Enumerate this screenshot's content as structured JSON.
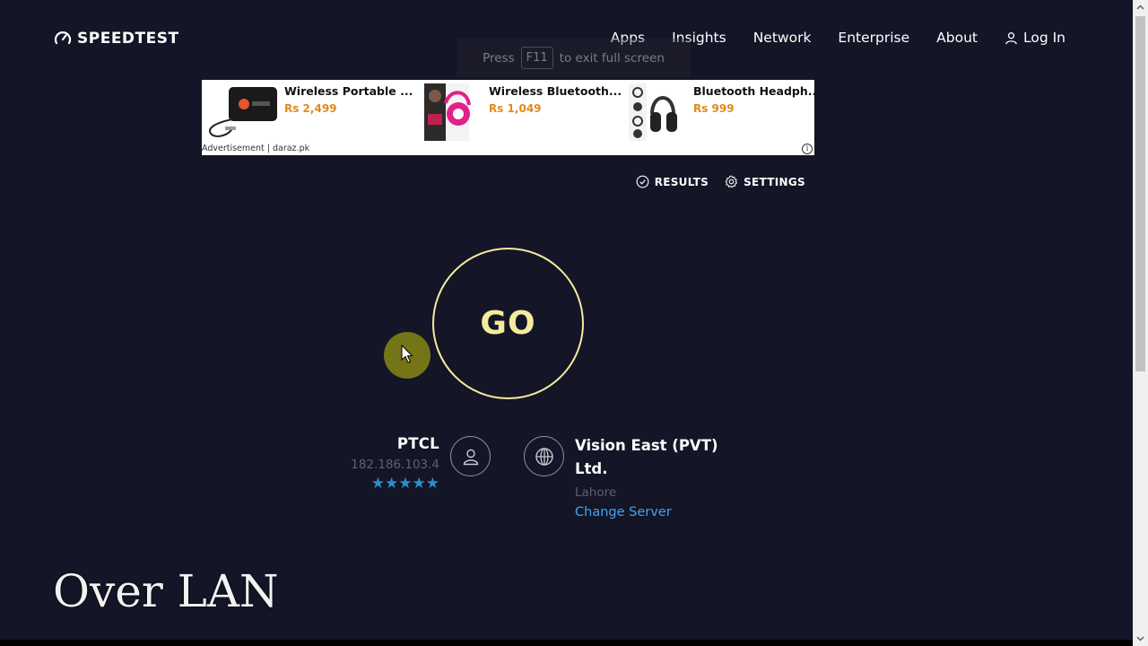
{
  "header": {
    "logo_text": "SPEEDTEST",
    "nav": [
      "Apps",
      "Insights",
      "Network",
      "Enterprise",
      "About"
    ],
    "login_label": "Log In"
  },
  "fullscreen_hint": {
    "prefix": "Press",
    "key": "F11",
    "suffix": "to exit full screen"
  },
  "ad": {
    "items": [
      {
        "title": "Wireless Portable ...",
        "price": "Rs 2,499"
      },
      {
        "title": "Wireless Bluetooth...",
        "price": "Rs 1,049"
      },
      {
        "title": "Bluetooth Headph...",
        "price": "Rs 999"
      }
    ],
    "footer": "Advertisement | daraz.pk",
    "info_icon": "i"
  },
  "toolbar": {
    "results_label": "RESULTS",
    "settings_label": "SETTINGS"
  },
  "go_label": "GO",
  "isp": {
    "name": "PTCL",
    "ip": "182.186.103.4",
    "stars": "★★★★★",
    "rating": 5
  },
  "server": {
    "name": "Vision East (PVT) Ltd.",
    "location": "Lahore",
    "change_label": "Change Server"
  },
  "caption": "Over LAN",
  "colors": {
    "background": "#141526",
    "go_ring": "#f3ec9e",
    "link": "#41a6f0",
    "stars": "#2a8fce",
    "price": "#e08a1e"
  }
}
